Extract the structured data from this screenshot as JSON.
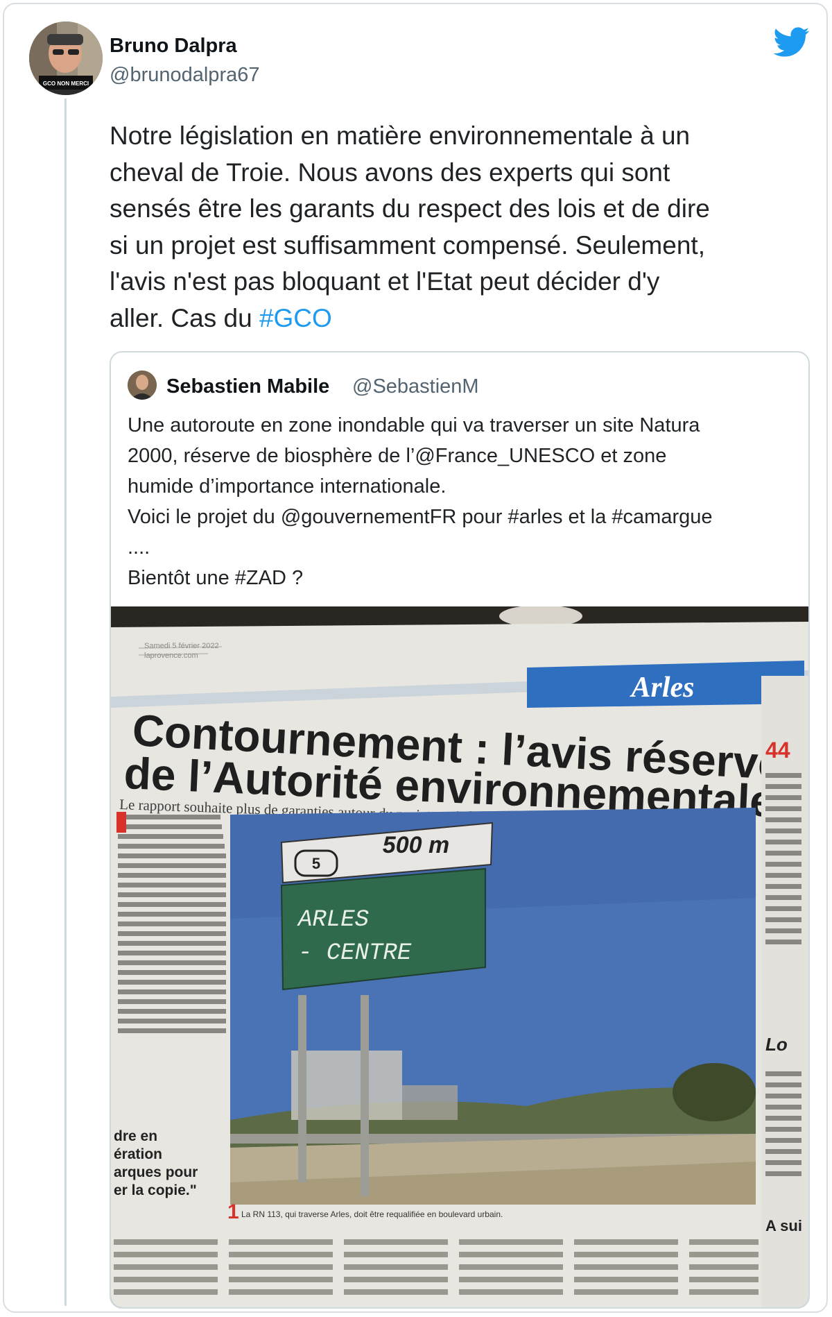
{
  "tweet": {
    "author_name": "Bruno Dalpra",
    "author_handle": "@brunodalpra67",
    "text_lines": [
      "Notre législation en matière environnementale à un",
      "cheval de Troie. Nous avons des experts qui sont",
      "sensés être les garants du respect des lois et de dire",
      "si un projet est suffisamment compensé. Seulement,",
      "l'avis n'est pas bloquant et l'Etat peut décider d'y"
    ],
    "text_last_line": "aller. Cas du ",
    "hashtag": "#GCO",
    "avatar_badge": "GCO NON MERCI"
  },
  "quoted_tweet": {
    "author_name": "Sebastien Mabile",
    "author_handle": "@SebastienM",
    "text_lines": [
      "Une autoroute en zone inondable qui va traverser un site Natura",
      "2000, réserve de biosphère de l’@France_UNESCO et zone",
      "humide d’importance internationale.",
      "Voici le projet du @gouvernementFR pour #arles et la #camargue",
      "....",
      "Bientôt une #ZAD ?"
    ]
  },
  "newspaper": {
    "section": "Arles",
    "date": "Samedi 5 février 2022",
    "site": "laprovence.com",
    "headline_line1": "Contournement : l’avis réservé",
    "headline_line2": "de l’Autorité environnementale",
    "subheadline": "Le rapport souhaite plus de garanties autour du projet, mais les élus ne sont pas inquiets",
    "sign_top": "500 m",
    "sign_exit": "5",
    "sign_line1": "ARLES",
    "sign_line2": "- CENTRE",
    "caption": "La RN 113, qui traverse Arles, doit être requalifiée en boulevard urbain.",
    "side_number": "44",
    "side_heading": "Lo",
    "side_continue": "A sui",
    "quote_snippet": [
      "dre en",
      "ération",
      "arques pour",
      "er la copie.\""
    ]
  },
  "colors": {
    "link": "#1d9bf0",
    "twitter_blue": "#1d9bf0",
    "muted_text": "#536471",
    "border": "#cfd9de",
    "newspaper_band": "#2f6fbf",
    "sign_green": "#2f6a4c",
    "sky": "#4a73b6"
  },
  "icons": {
    "logo": "twitter-bird-icon"
  }
}
